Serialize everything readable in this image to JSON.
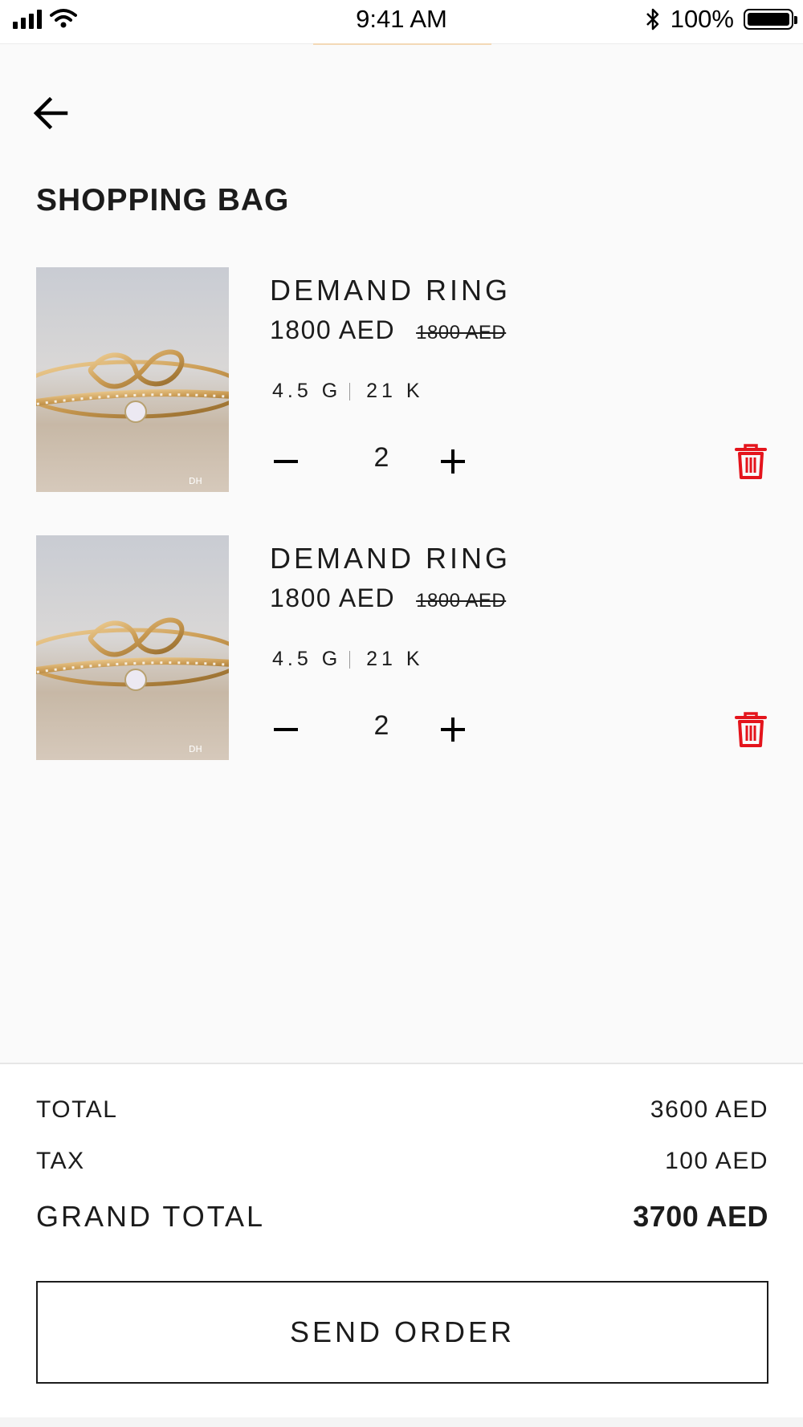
{
  "status_bar": {
    "time": "9:41 AM",
    "battery_percent": "100%",
    "icons": [
      "signal-icon",
      "wifi-icon",
      "bluetooth-icon",
      "battery-icon"
    ]
  },
  "header": {
    "back_icon": "arrow-left-icon",
    "title": "SHOPPING BAG"
  },
  "cart_items": [
    {
      "name": "DEMAND RING",
      "price": "1800 AED",
      "old_price": "1800 AED",
      "weight": "4.5 G",
      "karat": "21 K",
      "quantity": "2",
      "image": "ring-photo"
    },
    {
      "name": "DEMAND RING",
      "price": "1800 AED",
      "old_price": "1800 AED",
      "weight": "4.5 G",
      "karat": "21 K",
      "quantity": "2",
      "image": "ring-photo"
    }
  ],
  "summary": {
    "total_label": "TOTAL",
    "total_value": "3600 AED",
    "tax_label": "TAX",
    "tax_value": "100 AED",
    "grand_total_label": "GRAND TOTAL",
    "grand_total_value": "3700 AED"
  },
  "actions": {
    "send_order_label": "SEND ORDER"
  },
  "colors": {
    "background": "#fafafa",
    "text": "#1c1c1c",
    "delete": "#e4141c",
    "accent": "#f3d9b6"
  }
}
